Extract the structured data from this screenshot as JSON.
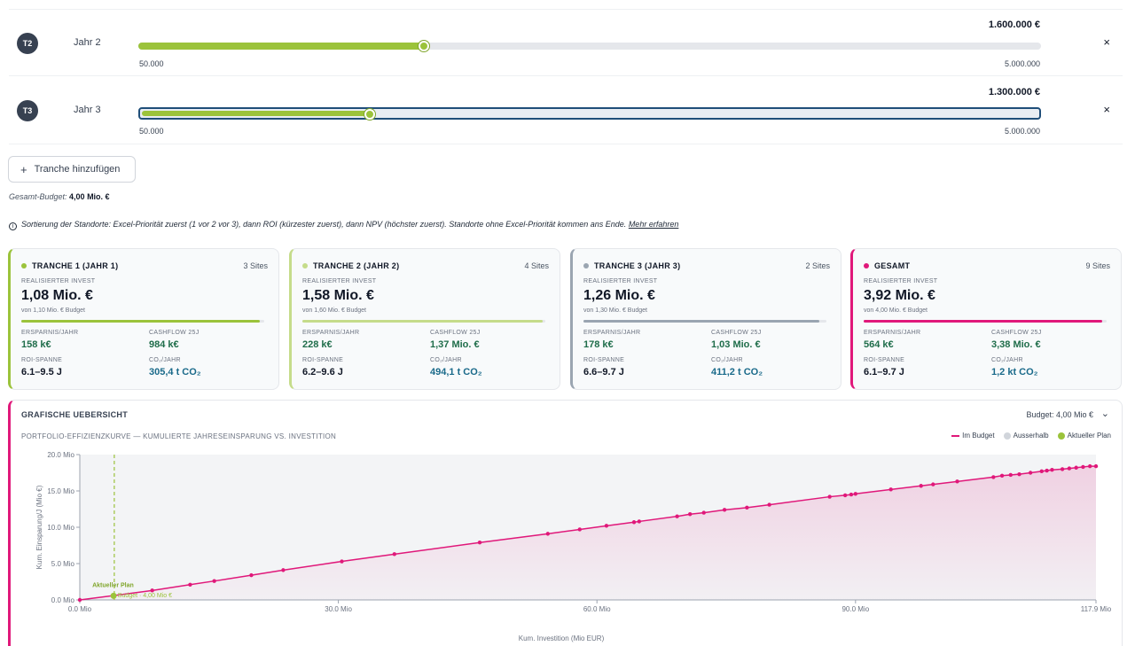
{
  "tranches": [
    {
      "badge": "T2",
      "label": "Jahr 2",
      "amount": "1.600.000 €",
      "min": "50.000",
      "max": "5.000.000",
      "fraction": 0.3163
    },
    {
      "badge": "T3",
      "label": "Jahr 3",
      "amount": "1.300.000 €",
      "min": "50.000",
      "max": "5.000.000",
      "fraction": 0.2557
    }
  ],
  "close_icon": "×",
  "add_button": {
    "icon": "+",
    "label": "Tranche hinzufügen"
  },
  "total_budget": {
    "label": "Gesamt-Budget:",
    "value": "4,00 Mio. €"
  },
  "info": {
    "icon": "i",
    "text": "Sortierung der Standorte: Excel-Priorität zuerst (1 vor 2 vor 3), dann ROI (kürzester zuerst), dann NPV (höchster zuerst). Standorte ohne Excel-Priorität kommen ans Ende.",
    "link": "Mehr erfahren"
  },
  "cards": [
    {
      "title": "TRANCHE 1 (JAHR 1)",
      "sites": "3 Sites",
      "color": "#9bc33b",
      "invest_label": "REALISIERTER INVEST",
      "invest": "1,08 Mio. €",
      "von": "von 1,10 Mio. € Budget",
      "fill": 0.98,
      "ersparnis_label": "ERSPARNIS/JAHR",
      "ersparnis": "158 k€",
      "cashflow_label": "CASHFLOW 25J",
      "cashflow": "984 k€",
      "roi_label": "ROI-SPANNE",
      "roi": "6.1–9.5 J",
      "co2_label": "CO₂/JAHR",
      "co2": "305,4 t CO₂"
    },
    {
      "title": "TRANCHE 2 (JAHR 2)",
      "sites": "4 Sites",
      "color": "#c5dc8a",
      "invest_label": "REALISIERTER INVEST",
      "invest": "1,58 Mio. €",
      "von": "von 1,60 Mio. € Budget",
      "fill": 0.99,
      "ersparnis_label": "ERSPARNIS/JAHR",
      "ersparnis": "228 k€",
      "cashflow_label": "CASHFLOW 25J",
      "cashflow": "1,37 Mio. €",
      "roi_label": "ROI-SPANNE",
      "roi": "6.2–9.6 J",
      "co2_label": "CO₂/JAHR",
      "co2": "494,1 t CO₂"
    },
    {
      "title": "TRANCHE 3 (JAHR 3)",
      "sites": "2 Sites",
      "color": "#9aa5b1",
      "invest_label": "REALISIERTER INVEST",
      "invest": "1,26 Mio. €",
      "von": "von 1,30 Mio. € Budget",
      "fill": 0.97,
      "ersparnis_label": "ERSPARNIS/JAHR",
      "ersparnis": "178 k€",
      "cashflow_label": "CASHFLOW 25J",
      "cashflow": "1,03 Mio. €",
      "roi_label": "ROI-SPANNE",
      "roi": "6.6–9.7 J",
      "co2_label": "CO₂/JAHR",
      "co2": "411,2 t CO₂"
    },
    {
      "title": "GESAMT",
      "sites": "9 Sites",
      "color": "#e0187a",
      "invest_label": "REALISIERTER INVEST",
      "invest": "3,92 Mio. €",
      "von": "von 4,00 Mio. € Budget",
      "fill": 0.98,
      "ersparnis_label": "ERSPARNIS/JAHR",
      "ersparnis": "564 k€",
      "cashflow_label": "CASHFLOW 25J",
      "cashflow": "3,38 Mio. €",
      "roi_label": "ROI-SPANNE",
      "roi": "6.1–9.7 J",
      "co2_label": "CO₂/JAHR",
      "co2": "1,2 kt CO₂"
    }
  ],
  "panel": {
    "title": "GRAFISCHE UEBERSICHT",
    "budget": "Budget: 4,00 Mio €",
    "chevron": "⌄",
    "subtitle": "PORTFOLIO-EFFIZIENZKURVE — KUMULIERTE JAHRESEINSPARUNG VS. INVESTITION",
    "legend": [
      {
        "label": "Im Budget",
        "color": "#e0187a",
        "shape": "line"
      },
      {
        "label": "Ausserhalb",
        "color": "#d1d5db",
        "shape": "dot"
      },
      {
        "label": "Aktueller Plan",
        "color": "#9bc33b",
        "shape": "dot"
      }
    ]
  },
  "chart_data": {
    "type": "line",
    "xlabel": "Kum. Investition (Mio EUR)",
    "ylabel": "Kum. Einsparung/J (Mio €)",
    "xlim": [
      0,
      117.9
    ],
    "ylim": [
      0,
      20
    ],
    "xticks": [
      "0.0 Mio",
      "30.0 Mio",
      "60.0 Mio",
      "90.0 Mio",
      "117.9 Mio"
    ],
    "xtick_values": [
      0,
      30,
      60,
      90,
      117.9
    ],
    "yticks": [
      "0.0 Mio",
      "5.0 Mio",
      "10.0 Mio",
      "15.0 Mio",
      "20.0 Mio"
    ],
    "ytick_values": [
      0,
      5,
      10,
      15,
      20
    ],
    "grid": false,
    "series": [
      {
        "name": "Im Budget",
        "color": "#e0187a",
        "x": [
          0,
          3.9,
          8.4,
          12.8,
          15.6,
          19.9,
          23.6,
          30.4,
          36.5,
          46.4,
          54.3,
          58.0,
          61.1,
          64.3,
          64.9,
          69.3,
          70.8,
          72.4,
          74.8,
          77.4,
          80.0,
          87.0,
          88.8,
          89.5,
          90.0,
          94.1,
          97.6,
          99.0,
          101.8,
          106.0,
          107.0,
          108.0,
          109.0,
          110.3,
          111.6,
          112.2,
          112.8,
          114.0,
          114.8,
          115.6,
          116.4,
          117.2,
          117.9
        ],
        "y": [
          0,
          0.6,
          1.3,
          2.1,
          2.6,
          3.4,
          4.1,
          5.3,
          6.3,
          7.9,
          9.1,
          9.7,
          10.2,
          10.7,
          10.8,
          11.5,
          11.8,
          12.0,
          12.4,
          12.7,
          13.1,
          14.2,
          14.4,
          14.5,
          14.6,
          15.2,
          15.7,
          15.9,
          16.3,
          16.9,
          17.1,
          17.2,
          17.3,
          17.5,
          17.7,
          17.8,
          17.9,
          18.0,
          18.1,
          18.2,
          18.3,
          18.4,
          18.4
        ]
      }
    ],
    "current_plan": {
      "label": "Aktueller Plan",
      "x": 3.92,
      "y": 0.56
    },
    "budget_line": {
      "label": "Budget · 4,00 Mio €",
      "x": 4.0
    }
  }
}
